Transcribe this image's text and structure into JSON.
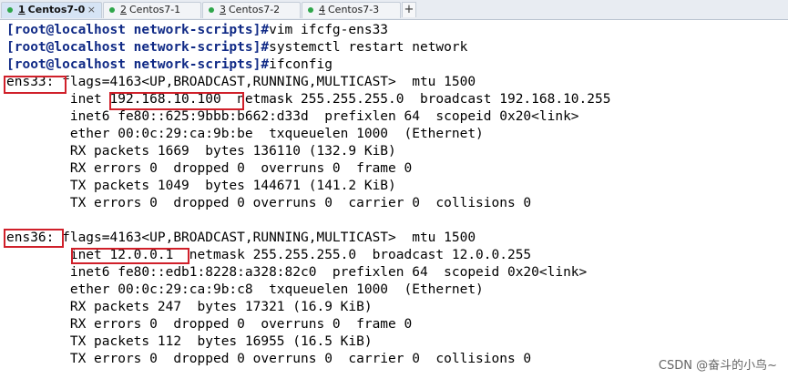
{
  "tabs": [
    {
      "number": "1",
      "name": "Centos7-0",
      "active": true
    },
    {
      "number": "2",
      "name": "Centos7-1",
      "active": false
    },
    {
      "number": "3",
      "name": "Centos7-2",
      "active": false
    },
    {
      "number": "4",
      "name": "Centos7-3",
      "active": false
    }
  ],
  "close_glyph": "×",
  "new_tab_glyph": "+",
  "terminal": {
    "commands": [
      {
        "prompt": "[root@localhost network-scripts]#",
        "cmd": "vim ifcfg-ens33"
      },
      {
        "prompt": "[root@localhost network-scripts]#",
        "cmd": "systemctl restart network"
      },
      {
        "prompt": "[root@localhost network-scripts]#",
        "cmd": "ifconfig"
      }
    ],
    "ens33": [
      "ens33: flags=4163<UP,BROADCAST,RUNNING,MULTICAST>  mtu 1500",
      "        inet 192.168.10.100  netmask 255.255.255.0  broadcast 192.168.10.255",
      "        inet6 fe80::625:9bbb:b662:d33d  prefixlen 64  scopeid 0x20<link>",
      "        ether 00:0c:29:ca:9b:be  txqueuelen 1000  (Ethernet)",
      "        RX packets 1669  bytes 136110 (132.9 KiB)",
      "        RX errors 0  dropped 0  overruns 0  frame 0",
      "        TX packets 1049  bytes 144671 (141.2 KiB)",
      "        TX errors 0  dropped 0 overruns 0  carrier 0  collisions 0"
    ],
    "ens36": [
      "ens36: flags=4163<UP,BROADCAST,RUNNING,MULTICAST>  mtu 1500",
      "        inet 12.0.0.1  netmask 255.255.255.0  broadcast 12.0.0.255",
      "        inet6 fe80::edb1:8228:a328:82c0  prefixlen 64  scopeid 0x20<link>",
      "        ether 00:0c:29:ca:9b:c8  txqueuelen 1000  (Ethernet)",
      "        RX packets 247  bytes 17321 (16.9 KiB)",
      "        RX errors 0  dropped 0  overruns 0  frame 0",
      "        TX packets 112  bytes 16955 (16.5 KiB)",
      "        TX errors 0  dropped 0 overruns 0  carrier 0  collisions 0"
    ]
  },
  "watermark": "CSDN @奋斗的小鸟~",
  "colors": {
    "prompt": "#102a86",
    "highlight_box": "#d0202a",
    "active_tab_dot": "#2fa64a"
  }
}
